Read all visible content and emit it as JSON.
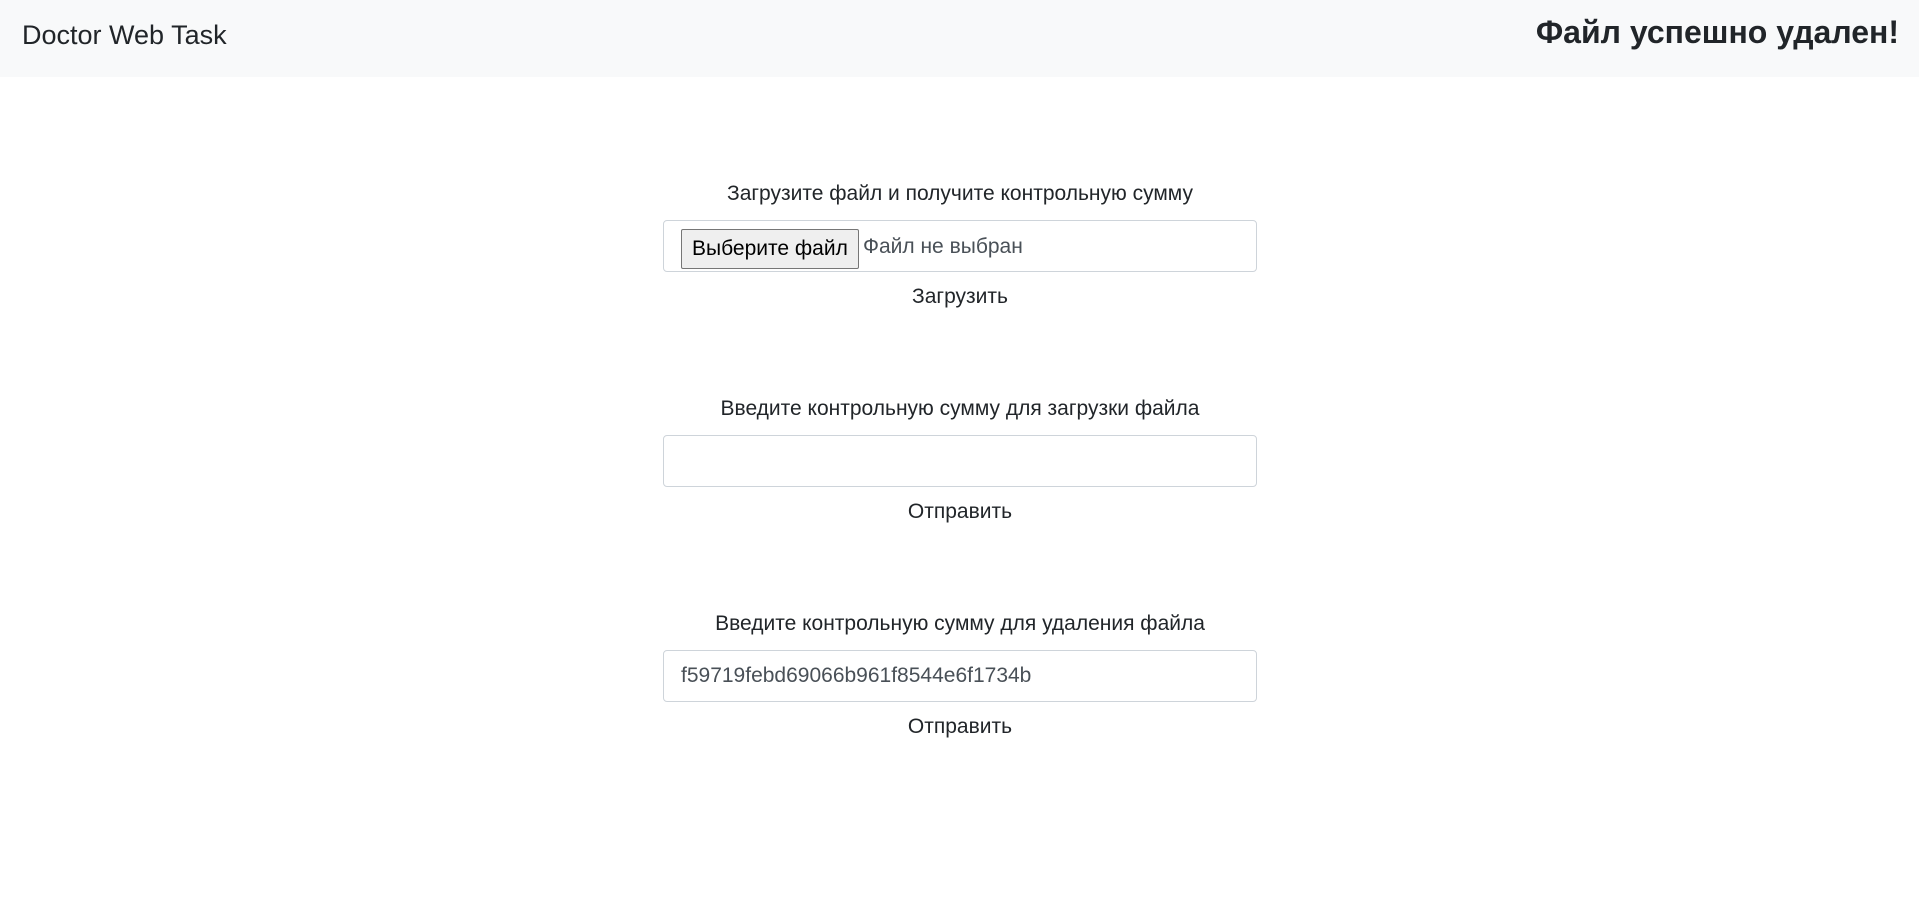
{
  "navbar": {
    "brand": "Doctor Web Task",
    "status_message": "Файл успешно удален!"
  },
  "upload": {
    "label": "Загрузите файл и получите контрольную сумму",
    "choose_file_button": "Выберите файл",
    "file_status": "Файл не выбран",
    "submit_label": "Загрузить"
  },
  "download": {
    "label": "Введите контрольную сумму для загрузки файла",
    "input_value": "",
    "submit_label": "Отправить"
  },
  "delete": {
    "label": "Введите контрольную сумму для удаления файла",
    "input_value": "f59719febd69066b961f8544e6f1734b",
    "submit_label": "Отправить"
  }
}
